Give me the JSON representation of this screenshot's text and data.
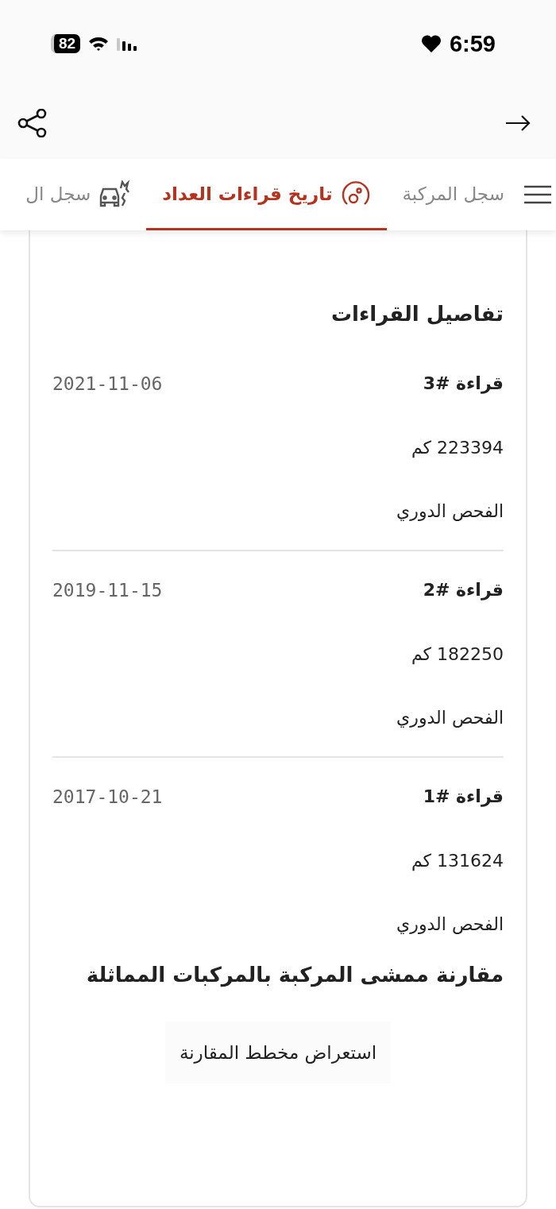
{
  "status_bar": {
    "battery": "82",
    "time": "6:59"
  },
  "tabs": [
    {
      "label": "سجل المركبة",
      "selected": false,
      "kind": "plain"
    },
    {
      "label": "تاريخ قراءات العداد",
      "selected": true,
      "kind": "gauge"
    },
    {
      "label": "سجل ال",
      "selected": false,
      "kind": "car"
    }
  ],
  "section_title": "تفاصيل القراءات",
  "readings": [
    {
      "label": "قراءة #3",
      "date": "2021-11-06",
      "odometer": "223394 كم",
      "type": "الفحص الدوري"
    },
    {
      "label": "قراءة #2",
      "date": "2019-11-15",
      "odometer": "182250 كم",
      "type": "الفحص الدوري"
    },
    {
      "label": "قراءة #1",
      "date": "2017-10-21",
      "odometer": "131624 كم",
      "type": "الفحص الدوري"
    }
  ],
  "comparison": {
    "title": "مقارنة ممشى المركبة بالمركبات المماثلة",
    "button": "استعراض مخطط المقارنة"
  }
}
